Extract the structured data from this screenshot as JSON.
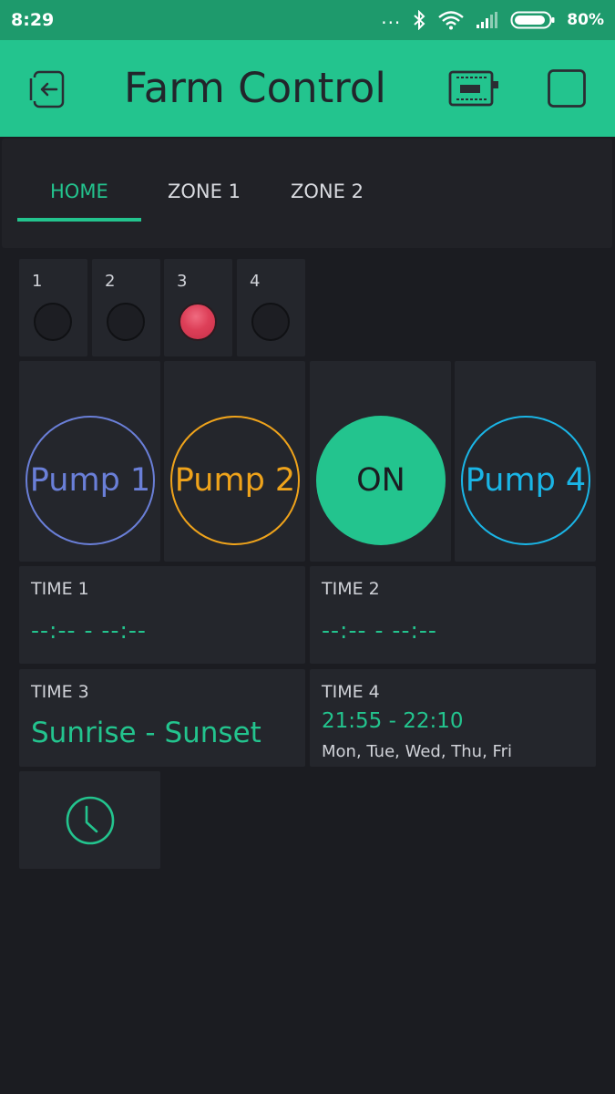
{
  "status_bar": {
    "time": "8:29",
    "battery_percent": "80%"
  },
  "app": {
    "title": "Farm Control"
  },
  "tabs": [
    {
      "label": "HOME",
      "active": true
    },
    {
      "label": "ZONE 1",
      "active": false
    },
    {
      "label": "ZONE 2",
      "active": false
    }
  ],
  "leds": [
    {
      "label": "1",
      "state": "off"
    },
    {
      "label": "2",
      "state": "off"
    },
    {
      "label": "3",
      "state": "on"
    },
    {
      "label": "4",
      "state": "off"
    }
  ],
  "pumps": [
    {
      "label": "Pump 1",
      "color": "#6a7fd8",
      "filled": false
    },
    {
      "label": "Pump 2",
      "color": "#efa31b",
      "filled": false
    },
    {
      "label": "ON",
      "color": "#23c48e",
      "filled": true
    },
    {
      "label": "Pump 4",
      "color": "#1ab5e6",
      "filled": false
    }
  ],
  "timers": {
    "time1": {
      "label": "TIME 1",
      "value": "--:-- - --:--"
    },
    "time2": {
      "label": "TIME 2",
      "value": "--:-- - --:--"
    },
    "time3": {
      "label": "TIME 3",
      "value": "Sunrise - Sunset"
    },
    "time4": {
      "label": "TIME 4",
      "value": "21:55 - 22:10",
      "days": "Mon, Tue, Wed, Thu, Fri"
    }
  },
  "icons": {
    "back": "exit-to-left-icon",
    "device": "device-board-icon",
    "stop": "square-icon",
    "clock": "clock-icon"
  },
  "colors": {
    "accent": "#23c48e",
    "background": "#1b1c21",
    "tile": "#24262c",
    "led_on": "#dd3f58"
  }
}
